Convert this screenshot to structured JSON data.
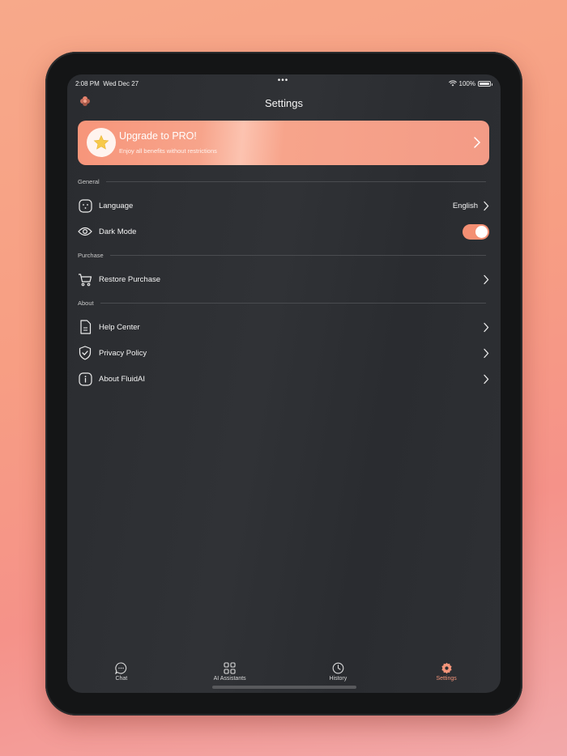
{
  "status_bar": {
    "time": "2:08 PM",
    "date": "Wed Dec 27",
    "dots": "•••",
    "battery": "100%"
  },
  "header": {
    "title": "Settings",
    "logo_icon": "flower-logo-icon"
  },
  "upgrade": {
    "title": "Upgrade to PRO!",
    "subtitle": "Enjoy all benefits without restrictions",
    "icon": "star-icon"
  },
  "sections": {
    "general": "General",
    "purchase": "Purchase",
    "about": "About"
  },
  "rows": {
    "language": {
      "label": "Language",
      "value": "English",
      "icon": "language-icon"
    },
    "dark_mode": {
      "label": "Dark Mode",
      "enabled": true,
      "icon": "eye-icon"
    },
    "restore": {
      "label": "Restore Purchase",
      "icon": "cart-icon"
    },
    "help": {
      "label": "Help Center",
      "icon": "document-icon"
    },
    "privacy": {
      "label": "Privacy Policy",
      "icon": "shield-check-icon"
    },
    "about_app": {
      "label": "About FluidAI",
      "icon": "info-icon"
    }
  },
  "tabs": [
    {
      "label": "Chat",
      "icon": "chat-bubble-icon",
      "active": false
    },
    {
      "label": "AI Assistants",
      "icon": "grid-icon",
      "active": false
    },
    {
      "label": "History",
      "icon": "clock-icon",
      "active": false
    },
    {
      "label": "Settings",
      "icon": "gear-icon",
      "active": true
    }
  ],
  "colors": {
    "accent": "#f4957a",
    "background": "#2c2e32",
    "card": "#f7a48b"
  }
}
